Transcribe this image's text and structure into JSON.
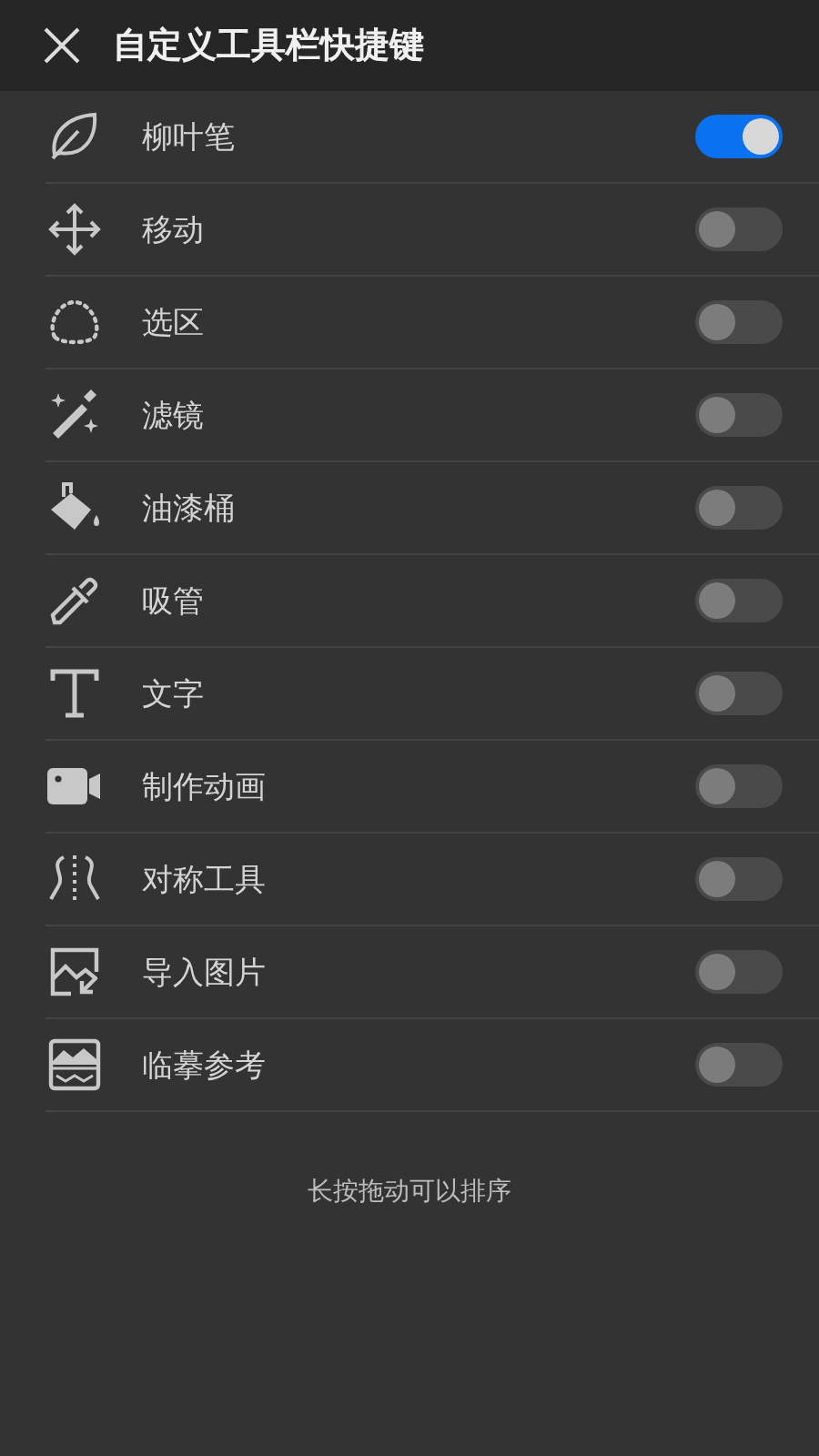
{
  "header": {
    "title": "自定义工具栏快捷键"
  },
  "items": [
    {
      "label": "柳叶笔",
      "on": true
    },
    {
      "label": "移动",
      "on": false
    },
    {
      "label": "选区",
      "on": false
    },
    {
      "label": "滤镜",
      "on": false
    },
    {
      "label": "油漆桶",
      "on": false
    },
    {
      "label": "吸管",
      "on": false
    },
    {
      "label": "文字",
      "on": false
    },
    {
      "label": "制作动画",
      "on": false
    },
    {
      "label": "对称工具",
      "on": false
    },
    {
      "label": "导入图片",
      "on": false
    },
    {
      "label": "临摹参考",
      "on": false
    }
  ],
  "hint": "长按拖动可以排序"
}
